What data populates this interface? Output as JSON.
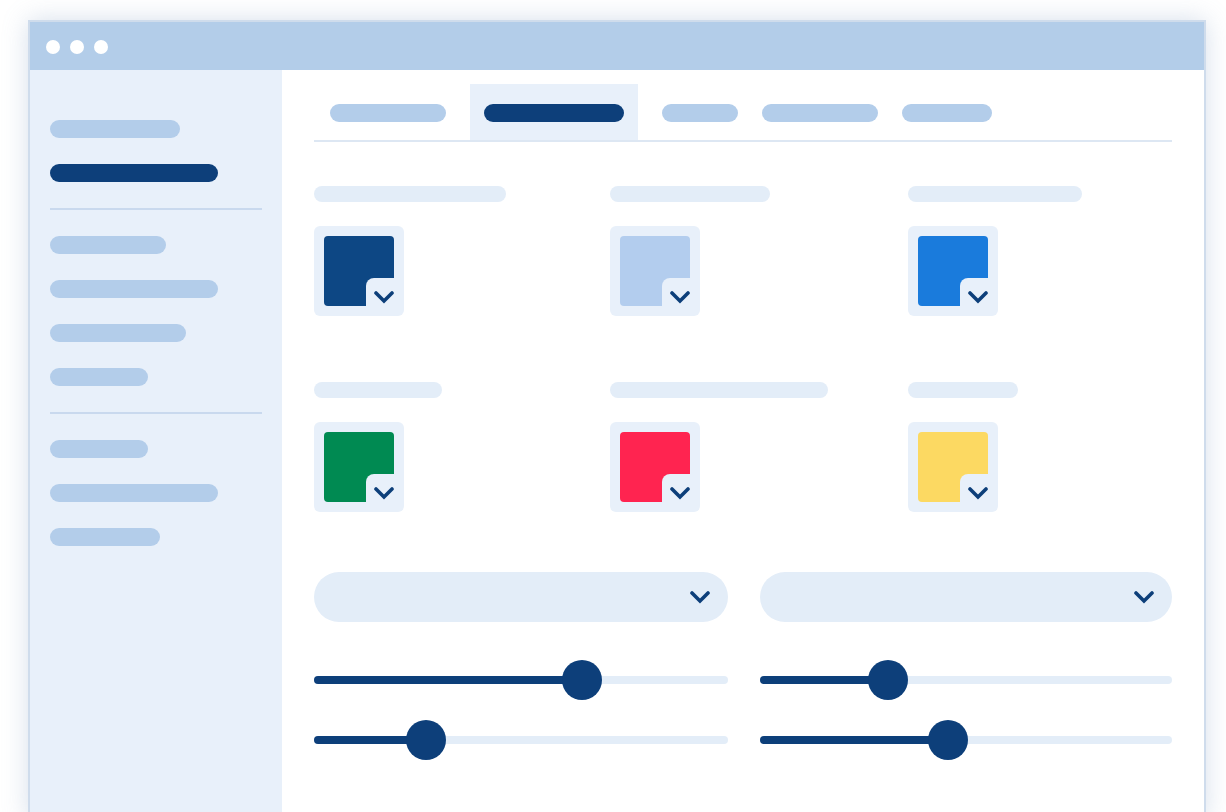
{
  "sidebar": {
    "groups": [
      [
        {
          "selected": false
        },
        {
          "selected": true
        }
      ],
      [
        {
          "selected": false
        },
        {
          "selected": false
        },
        {
          "selected": false
        },
        {
          "selected": false
        }
      ],
      [
        {
          "selected": false
        },
        {
          "selected": false
        },
        {
          "selected": false
        }
      ]
    ]
  },
  "tabs": [
    {
      "selected": false
    },
    {
      "selected": true
    },
    {
      "selected": false
    },
    {
      "selected": false
    },
    {
      "selected": false
    }
  ],
  "swatches": [
    {
      "color": "#0d4784"
    },
    {
      "color": "#b3cdee"
    },
    {
      "color": "#1a7bdc"
    },
    {
      "color": "#008a52"
    },
    {
      "color": "#ff2450"
    },
    {
      "color": "#fcd962"
    }
  ],
  "dropdowns": [
    {
      "expanded": false
    },
    {
      "expanded": false
    }
  ],
  "sliders": [
    {
      "level": 0.65
    },
    {
      "level": 0.31
    },
    {
      "level": 0.27
    },
    {
      "level": 0.46
    }
  ]
}
